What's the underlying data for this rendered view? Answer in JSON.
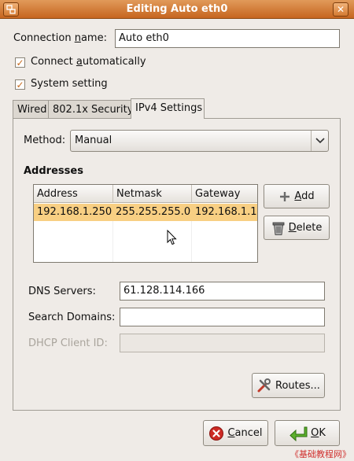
{
  "window": {
    "title": "Editing Auto eth0",
    "close_icon_glyph": "✕"
  },
  "connection_name": {
    "label_pre": "Connection ",
    "label_u": "n",
    "label_post": "ame:",
    "value": "Auto eth0"
  },
  "connect_auto": {
    "label_pre": "Connect ",
    "label_u": "a",
    "label_post": "utomatically",
    "checked": true
  },
  "system_setting": {
    "label": "System setting",
    "checked": true
  },
  "tabs": [
    {
      "label": "Wired"
    },
    {
      "label": "802.1x Security"
    },
    {
      "label": "IPv4 Settings"
    }
  ],
  "ipv4": {
    "method_label": "Method:",
    "method_value": "Manual",
    "addresses_heading": "Addresses",
    "columns": [
      "Address",
      "Netmask",
      "Gateway"
    ],
    "rows": [
      {
        "address": "192.168.1.250",
        "netmask": "255.255.255.0",
        "gateway": "192.168.1.1"
      }
    ],
    "add_button": {
      "u": "A",
      "rest": "dd"
    },
    "delete_button": {
      "u": "D",
      "rest": "elete"
    },
    "dns_label": "DNS Servers:",
    "dns_value": "61.128.114.166",
    "search_label": "Search Domains:",
    "search_value": "",
    "dhcp_label": "DHCP Client ID:",
    "dhcp_value": "",
    "routes_button": "Routes..."
  },
  "actions": {
    "cancel": {
      "u": "C",
      "rest": "ancel"
    },
    "ok": {
      "u": "O",
      "rest": "K"
    }
  },
  "watermark": "《基础教程网》",
  "colors": {
    "accent": "#c76a1d",
    "selection": "#f8cf83",
    "titlebar": "#d47a32"
  }
}
